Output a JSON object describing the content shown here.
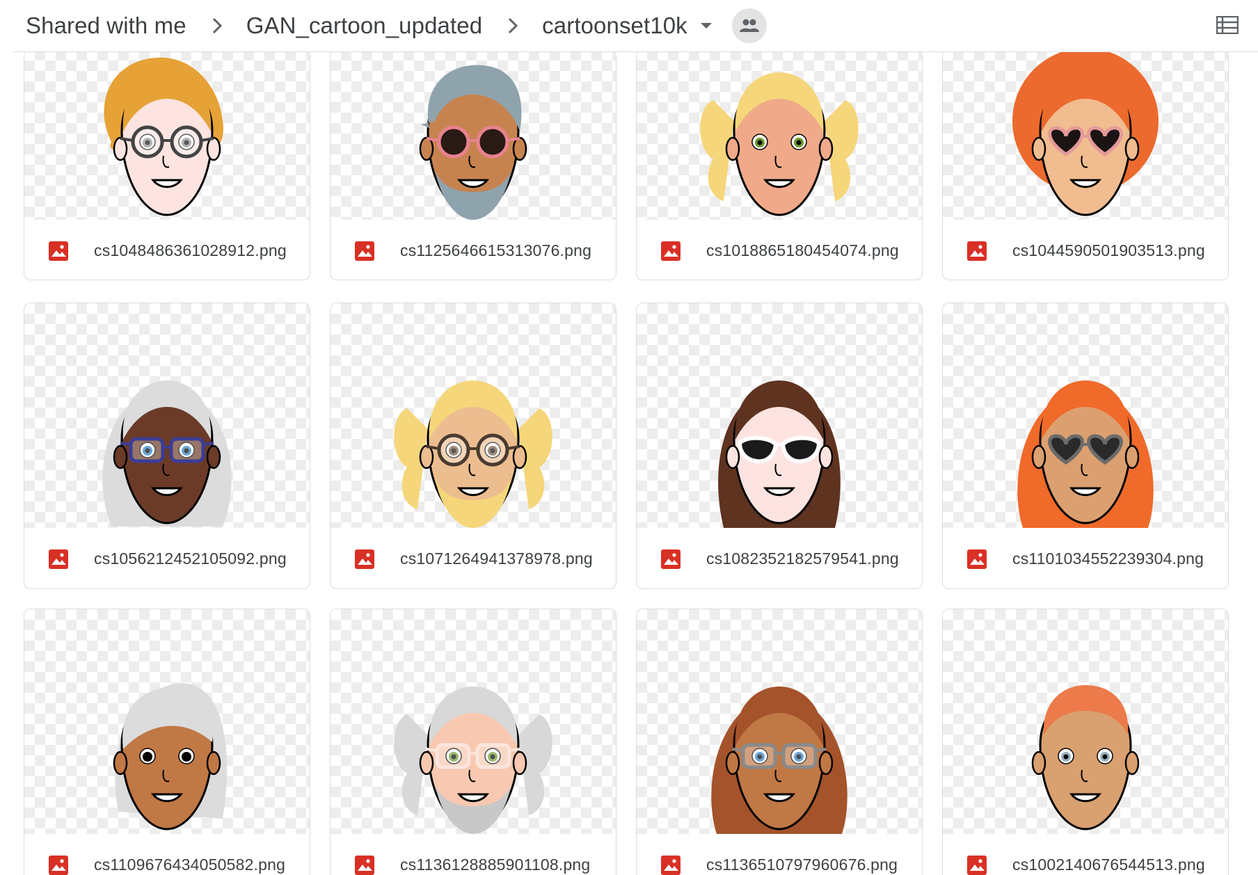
{
  "breadcrumb": {
    "items": [
      {
        "label": "Shared with me"
      },
      {
        "label": "GAN_cartoon_updated"
      },
      {
        "label": "cartoonset10k"
      }
    ]
  },
  "icons": {
    "chevron": "chevron-right-icon",
    "dropdown": "caret-down-icon",
    "shared": "people-icon",
    "view": "list-view-icon",
    "file": "image-file-icon"
  },
  "colors": {
    "file_icon": "#d93025",
    "border": "#dadce0",
    "text": "#3c4043"
  },
  "files": [
    {
      "name": "cs1048486361028912.png",
      "hair": "#e6a236",
      "hair_style": "curly",
      "skin": "#fde4e0",
      "glasses": "round",
      "glasses_color": "#444444",
      "lens": "#ffffff",
      "eye": "#8a8a8a",
      "beard": ""
    },
    {
      "name": "cs1125646615313076.png",
      "hair": "#8fa3ad",
      "hair_style": "short-side",
      "skin": "#c7834f",
      "glasses": "round",
      "glasses_color": "#e8838f",
      "lens": "#2a1a14",
      "eye": "#000000",
      "beard": "#8fa3ad"
    },
    {
      "name": "cs1018865180454074.png",
      "hair": "#f5d67a",
      "hair_style": "pigtails",
      "skin": "#f0aa8a",
      "glasses": "",
      "glasses_color": "",
      "lens": "",
      "eye": "#6c9a2e",
      "beard": ""
    },
    {
      "name": "cs1044590501903513.png",
      "hair": "#ec6a2d",
      "hair_style": "afro",
      "skin": "#f1bd90",
      "glasses": "heart",
      "glasses_color": "#e59a9a",
      "lens": "#1c1414",
      "eye": "#000000",
      "beard": ""
    },
    {
      "name": "cs1056212452105092.png",
      "hair": "#dcdcdc",
      "hair_style": "long",
      "skin": "#6b3b28",
      "glasses": "rect",
      "glasses_color": "#3b3d96",
      "lens": "#ffffff",
      "eye": "#2b7fc4",
      "beard": ""
    },
    {
      "name": "cs1071264941378978.png",
      "hair": "#f5d67a",
      "hair_style": "pigtails",
      "skin": "#ecbd8f",
      "glasses": "round",
      "glasses_color": "#4a3a30",
      "lens": "#ffffff",
      "eye": "#6b4a30",
      "beard": "#f5d67a"
    },
    {
      "name": "cs1082352182579541.png",
      "hair": "#5e3320",
      "hair_style": "bob",
      "skin": "#fde4e0",
      "glasses": "cat",
      "glasses_color": "#ffffff",
      "lens": "#1a1a1a",
      "eye": "#000000",
      "beard": ""
    },
    {
      "name": "cs1101034552239304.png",
      "hair": "#f06a2a",
      "hair_style": "long-wavy",
      "skin": "#dca070",
      "glasses": "heart",
      "glasses_color": "#6b6b6b",
      "lens": "#2a2a2a",
      "eye": "#000000",
      "beard": ""
    },
    {
      "name": "cs1109676434050582.png",
      "hair": "#dcdcdc",
      "hair_style": "side-swept",
      "skin": "#c07845",
      "glasses": "",
      "glasses_color": "",
      "lens": "",
      "eye": "#000000",
      "beard": ""
    },
    {
      "name": "cs1136128885901108.png",
      "hair": "#d8d8d8",
      "hair_style": "pigtails",
      "skin": "#f8c8b0",
      "glasses": "rect",
      "glasses_color": "#fbe5dc",
      "lens": "#ffffff",
      "eye": "#6c9a2e",
      "beard": "#c8c8c8"
    },
    {
      "name": "cs1136510797960676.png",
      "hair": "#a4532b",
      "hair_style": "long-wavy",
      "skin": "#c07845",
      "glasses": "rect",
      "glasses_color": "#8a8a8a",
      "lens": "#ffffff",
      "eye": "#2b7fc4",
      "beard": ""
    },
    {
      "name": "cs1002140676544513.png",
      "hair": "#ec7a4a",
      "hair_style": "buzz",
      "skin": "#d9a070",
      "glasses": "",
      "glasses_color": "",
      "lens": "",
      "eye": "#9ab0bc",
      "beard": ""
    }
  ]
}
